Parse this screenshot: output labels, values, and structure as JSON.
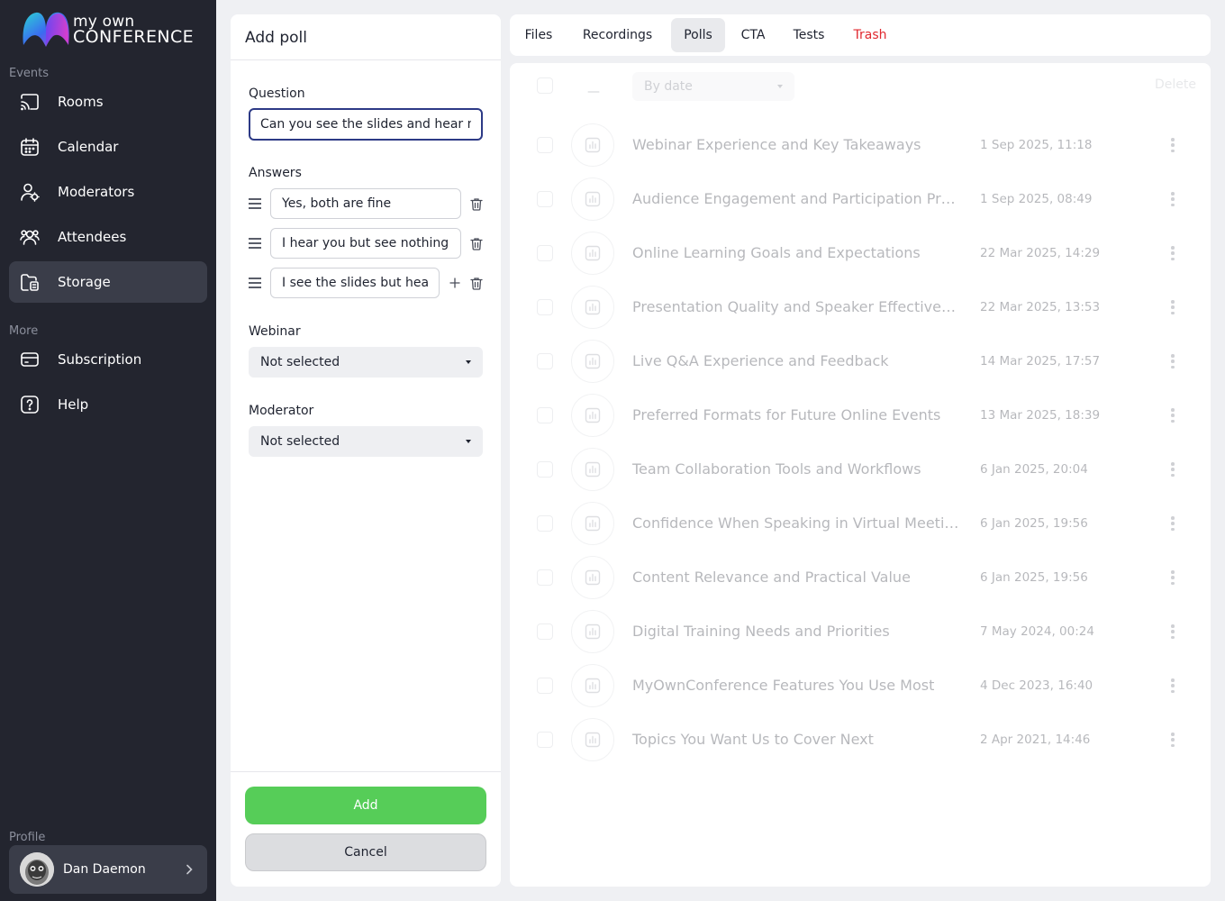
{
  "brand": {
    "line1": "my own",
    "line2": "CONFERENCE"
  },
  "sidebar": {
    "events_label": "Events",
    "more_label": "More",
    "profile_label": "Profile",
    "items": [
      {
        "label": "Rooms",
        "icon": "cast-icon"
      },
      {
        "label": "Calendar",
        "icon": "calendar-icon"
      },
      {
        "label": "Moderators",
        "icon": "moderator-icon"
      },
      {
        "label": "Attendees",
        "icon": "attendees-icon"
      },
      {
        "label": "Storage",
        "icon": "storage-icon",
        "active": true
      },
      {
        "label": "Subscription",
        "icon": "card-icon"
      },
      {
        "label": "Help",
        "icon": "help-icon"
      }
    ],
    "profile": {
      "name": "Dan Daemon"
    }
  },
  "poll_form": {
    "title": "Add poll",
    "question_label": "Question",
    "question_value": "Can you see the slides and hear me clearly?",
    "answers_label": "Answers",
    "answers": [
      "Yes, both are fine",
      "I hear you but see nothing",
      "I see the slides but hear nothing"
    ],
    "webinar_label": "Webinar",
    "webinar_value": "Not selected",
    "moderator_label": "Moderator",
    "moderator_value": "Not selected",
    "add_label": "Add",
    "cancel_label": "Cancel"
  },
  "tabs": [
    {
      "label": "Files"
    },
    {
      "label": "Recordings"
    },
    {
      "label": "Polls",
      "active": true
    },
    {
      "label": "CTA"
    },
    {
      "label": "Tests"
    },
    {
      "label": "Trash",
      "danger": true
    }
  ],
  "list": {
    "toolbar_dash": "—",
    "sort_value": "By date",
    "delete_label": "Delete",
    "rows": [
      {
        "title": "Webinar Experience and Key Takeaways",
        "date": "1 Sep 2025, 11:18"
      },
      {
        "title": "Audience Engagement and Participation Practices",
        "date": "1 Sep 2025, 08:49"
      },
      {
        "title": "Online Learning Goals and Expectations",
        "date": "22 Mar 2025, 14:29"
      },
      {
        "title": "Presentation Quality and Speaker Effectiveness",
        "date": "22 Mar 2025, 13:53"
      },
      {
        "title": "Live Q&A Experience and Feedback",
        "date": "14 Mar 2025, 17:57"
      },
      {
        "title": "Preferred Formats for Future Online Events",
        "date": "13 Mar 2025, 18:39"
      },
      {
        "title": "Team Collaboration Tools and Workflows",
        "date": "6 Jan 2025, 20:04"
      },
      {
        "title": "Confidence When Speaking in Virtual Meetings",
        "date": "6 Jan 2025, 19:56"
      },
      {
        "title": "Content Relevance and Practical Value",
        "date": "6 Jan 2025, 19:56"
      },
      {
        "title": "Digital Training Needs and Priorities",
        "date": "7 May 2024, 00:24"
      },
      {
        "title": "MyOwnConference Features You Use Most",
        "date": "4 Dec 2023, 16:40"
      },
      {
        "title": "Topics You Want Us to Cover Next",
        "date": "2 Apr 2021, 14:46"
      }
    ]
  },
  "colors": {
    "accent_green": "#56cd58",
    "sidebar_bg": "#23252f",
    "danger": "#e0282f",
    "focus_border": "#2d3a86"
  }
}
